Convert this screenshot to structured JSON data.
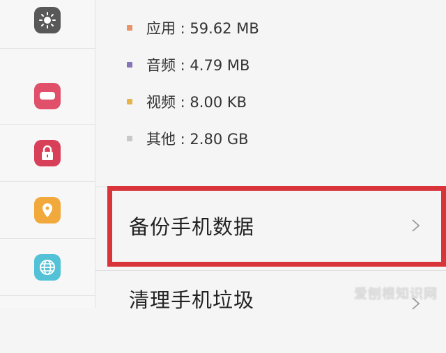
{
  "sidebar": {
    "icons": [
      {
        "name": "brightness-icon",
        "color": "#585858"
      },
      {
        "name": "battery-icon",
        "color": "#e0506a"
      },
      {
        "name": "lock-icon",
        "color": "#d8405a"
      },
      {
        "name": "location-icon",
        "color": "#f2a93b"
      },
      {
        "name": "globe-icon",
        "color": "#54c2d6"
      }
    ]
  },
  "storage": {
    "items": [
      {
        "label": "应用 : 59.62 MB",
        "color": "#e8946a"
      },
      {
        "label": "音频 : 4.79 MB",
        "color": "#8676b8"
      },
      {
        "label": "视频 : 8.00 KB",
        "color": "#e6b44a"
      },
      {
        "label": "其他 : 2.80 GB",
        "color": "#c8c8c8"
      }
    ]
  },
  "list": {
    "backup": "备份手机数据",
    "clean": "清理手机垃圾"
  },
  "watermark": "爱刨根知识网",
  "highlight_color": "#d8343a"
}
